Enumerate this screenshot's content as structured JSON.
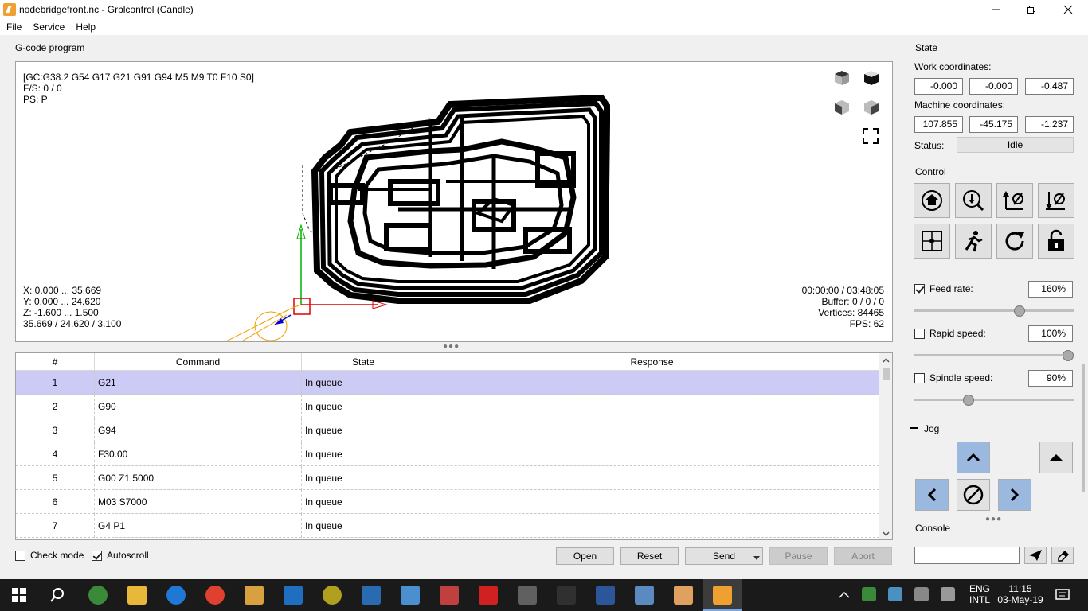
{
  "window": {
    "title": "nodebridgefront.nc - Grblcontrol  (Candle)"
  },
  "menu": [
    "File",
    "Service",
    "Help"
  ],
  "program": {
    "group_title": "G-code program",
    "info_top": [
      "[GC:G38.2 G54 G17 G21 G91 G94 M5 M9 T0 F10 S0]",
      "F/S: 0 / 0",
      "PS: P"
    ],
    "info_bottom_left": [
      "X: 0.000 ... 35.669",
      "Y: 0.000 ... 24.620",
      "Z: -1.600 ... 1.500",
      "35.669 / 24.620 / 3.100"
    ],
    "info_bottom_right": [
      "00:00:00 / 03:48:05",
      "Buffer: 0 / 0 / 0",
      "Vertices: 84465",
      "FPS: 62"
    ]
  },
  "table": {
    "headers": [
      "#",
      "Command",
      "State",
      "Response"
    ],
    "rows": [
      {
        "num": "1",
        "command": "G21",
        "state": "In queue",
        "response": ""
      },
      {
        "num": "2",
        "command": "G90",
        "state": "In queue",
        "response": ""
      },
      {
        "num": "3",
        "command": "G94",
        "state": "In queue",
        "response": ""
      },
      {
        "num": "4",
        "command": "F30.00",
        "state": "In queue",
        "response": ""
      },
      {
        "num": "5",
        "command": "G00 Z1.5000",
        "state": "In queue",
        "response": ""
      },
      {
        "num": "6",
        "command": "M03 S7000",
        "state": "In queue",
        "response": ""
      },
      {
        "num": "7",
        "command": "G4 P1",
        "state": "In queue",
        "response": ""
      }
    ]
  },
  "bottom": {
    "check_mode": "Check mode",
    "autoscroll": "Autoscroll",
    "buttons": {
      "open": "Open",
      "reset": "Reset",
      "send": "Send",
      "pause": "Pause",
      "abort": "Abort"
    }
  },
  "state": {
    "title": "State",
    "work_label": "Work coordinates:",
    "work": [
      "-0.000",
      "-0.000",
      "-0.487"
    ],
    "machine_label": "Machine coordinates:",
    "machine": [
      "107.855",
      "-45.175",
      "-1.237"
    ],
    "status_label": "Status:",
    "status": "Idle"
  },
  "control": {
    "title": "Control"
  },
  "override": {
    "feed": {
      "label": "Feed rate:",
      "value": "160%",
      "checked": true,
      "level": 0.67
    },
    "rapid": {
      "label": "Rapid speed:",
      "value": "100%",
      "checked": false,
      "level": 1.0
    },
    "spindle": {
      "label": "Spindle speed:",
      "value": "90%",
      "checked": false,
      "level": 0.33
    }
  },
  "jog": {
    "title": "Jog"
  },
  "console": {
    "title": "Console",
    "input": ""
  },
  "taskbar": {
    "lang": [
      "ENG",
      "INTL"
    ],
    "time": "11:15",
    "date": "03-May-19"
  },
  "colors": {
    "selection": "#cccbf5",
    "jog_blue": "#9bb8df"
  }
}
